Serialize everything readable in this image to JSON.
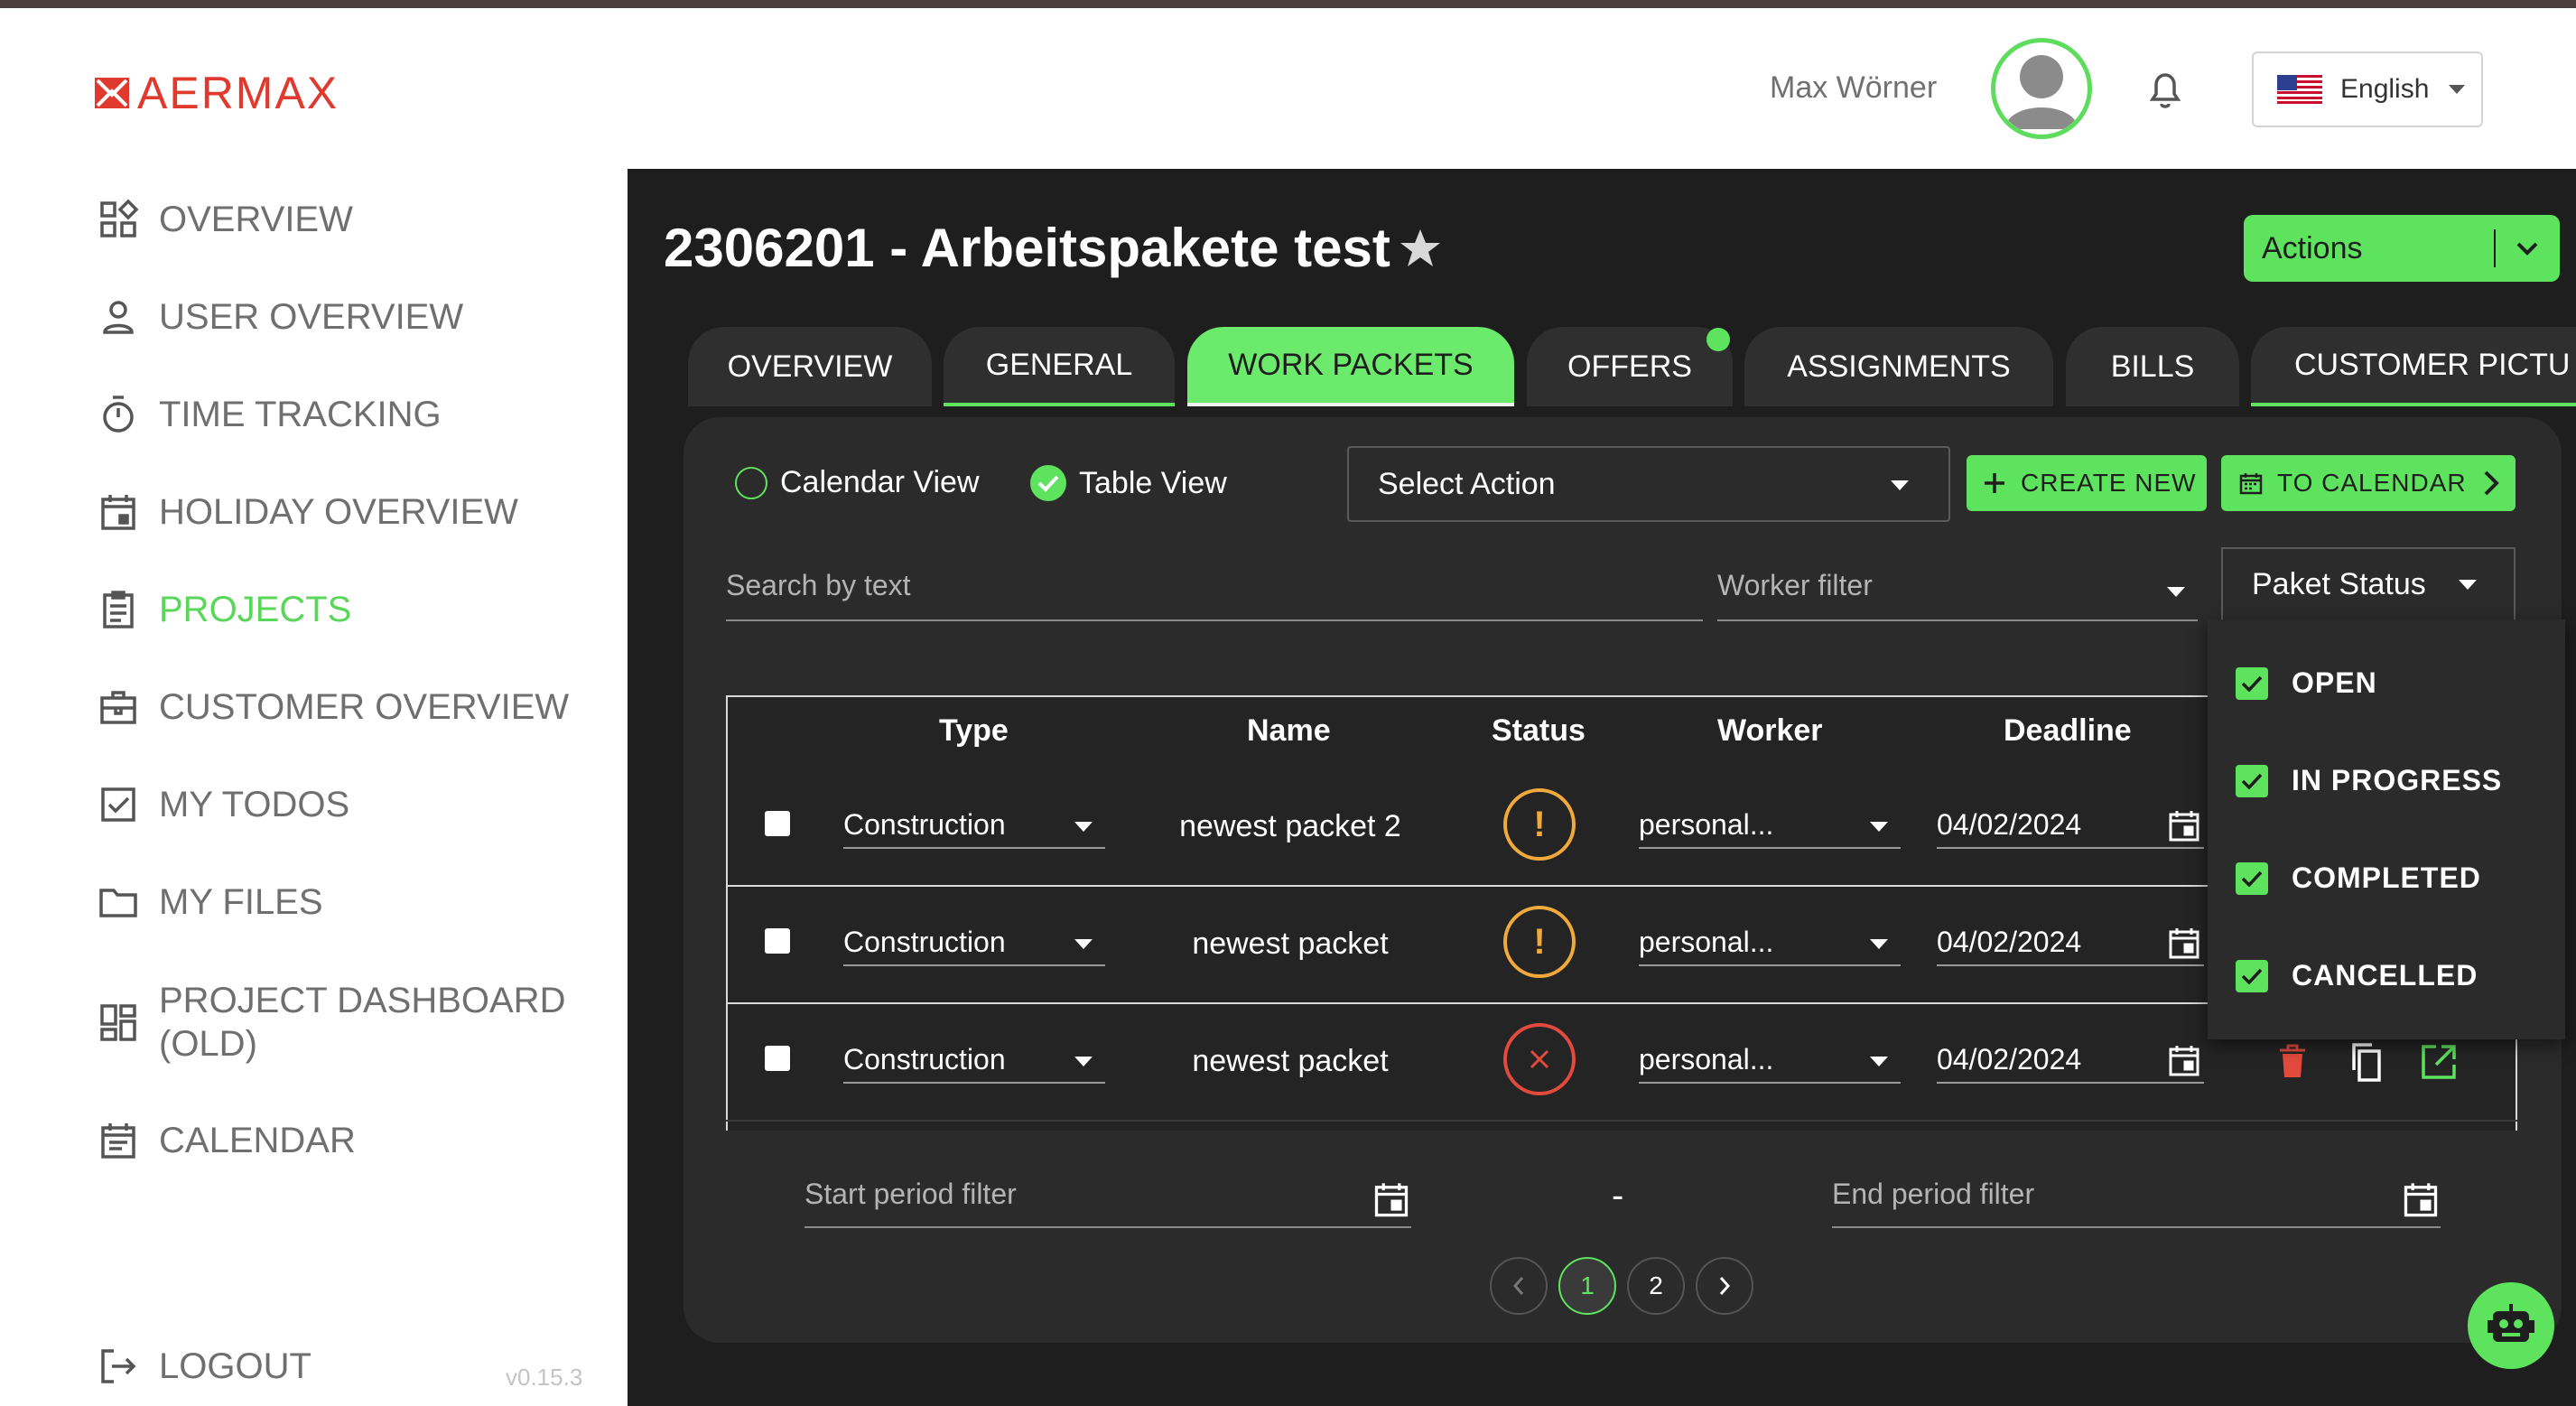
{
  "brand": {
    "name": "AERMAX"
  },
  "sidebar": {
    "items": [
      {
        "label": "OVERVIEW",
        "icon": "dashboard-icon"
      },
      {
        "label": "USER OVERVIEW",
        "icon": "person-icon"
      },
      {
        "label": "TIME TRACKING",
        "icon": "stopwatch-icon"
      },
      {
        "label": "HOLIDAY OVERVIEW",
        "icon": "calendar-icon"
      },
      {
        "label": "PROJECTS",
        "icon": "clipboard-icon",
        "active": true
      },
      {
        "label": "CUSTOMER OVERVIEW",
        "icon": "briefcase-icon"
      },
      {
        "label": "MY TODOS",
        "icon": "checkbox-icon"
      },
      {
        "label": "MY FILES",
        "icon": "folder-icon"
      },
      {
        "label": "PROJECT DASHBOARD (OLD)",
        "label_line1": "PROJECT DASHBOARD",
        "label_line2": "(OLD)",
        "icon": "grid-icon"
      },
      {
        "label": "CALENDAR",
        "icon": "calendar-icon"
      }
    ],
    "logout": "LOGOUT",
    "version": "v0.15.3"
  },
  "header": {
    "user_name": "Max Wörner",
    "language": "English"
  },
  "project": {
    "title": "2306201 - Arbeitspakete test",
    "actions_label": "Actions"
  },
  "tabs": [
    {
      "label": "OVERVIEW"
    },
    {
      "label": "GENERAL"
    },
    {
      "label": "WORK PACKETS",
      "active": true
    },
    {
      "label": "OFFERS",
      "has_dot": true
    },
    {
      "label": "ASSIGNMENTS"
    },
    {
      "label": "BILLS"
    },
    {
      "label": "CUSTOMER PICTU"
    }
  ],
  "toolbar": {
    "calendar_view": "Calendar View",
    "table_view": "Table View",
    "select_action": "Select Action",
    "create_new": "CREATE NEW",
    "to_calendar": "TO CALENDAR"
  },
  "filters": {
    "search_placeholder": "Search by text",
    "worker_filter": "Worker filter",
    "paket_status": "Paket Status",
    "start_period": "Start period filter",
    "dash": "-",
    "end_period": "End period filter"
  },
  "status_menu": [
    {
      "label": "OPEN",
      "checked": true
    },
    {
      "label": "IN PROGRESS",
      "checked": true
    },
    {
      "label": "COMPLETED",
      "checked": true
    },
    {
      "label": "CANCELLED",
      "checked": true
    }
  ],
  "table": {
    "headers": [
      "Type",
      "Name",
      "Status",
      "Worker",
      "Deadline"
    ],
    "rows": [
      {
        "type": "Construction",
        "name": "newest packet 2",
        "status": "warning",
        "worker": "personal...",
        "deadline": "04/02/2024"
      },
      {
        "type": "Construction",
        "name": "newest packet",
        "status": "warning",
        "worker": "personal...",
        "deadline": "04/02/2024"
      },
      {
        "type": "Construction",
        "name": "newest packet",
        "status": "cancelled",
        "worker": "personal...",
        "deadline": "04/02/2024"
      }
    ]
  },
  "pagination": {
    "pages": [
      "1",
      "2"
    ],
    "current": "1"
  },
  "colors": {
    "accent": "#5ee35e",
    "brand_red": "#e03a2f",
    "warning": "#f0a93b",
    "danger": "#e24a3d",
    "panel": "#1e1e1e"
  }
}
